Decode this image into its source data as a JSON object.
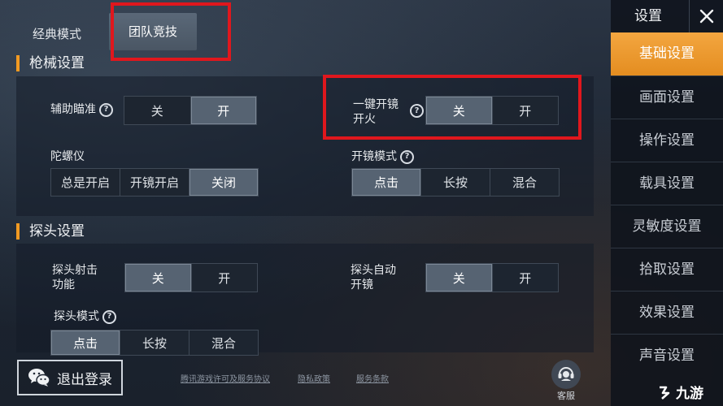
{
  "tabs": [
    {
      "label": "经典模式",
      "active": false
    },
    {
      "label": "团队竞技",
      "active": true
    }
  ],
  "sections": {
    "firearms": {
      "title": "枪械设置"
    },
    "peek": {
      "title": "探头设置"
    }
  },
  "settings": {
    "aim_assist": {
      "label": "辅助瞄准",
      "options": [
        "关",
        "开"
      ],
      "selected": "开"
    },
    "one_key_scope_fire": {
      "label_line1": "一键开镜",
      "label_line2": "开火",
      "options": [
        "关",
        "开"
      ],
      "selected": "关"
    },
    "gyro": {
      "label": "陀螺仪",
      "options": [
        "总是开启",
        "开镜开启",
        "关闭"
      ],
      "selected": "关闭"
    },
    "scope_mode": {
      "label": "开镜模式",
      "options": [
        "点击",
        "长按",
        "混合"
      ],
      "selected": "点击"
    },
    "peek_fire": {
      "label_line1": "探头射击",
      "label_line2": "功能",
      "options": [
        "关",
        "开"
      ],
      "selected": "关"
    },
    "peek_auto_scope": {
      "label_line1": "探头自动",
      "label_line2": "开镜",
      "options": [
        "关",
        "开"
      ],
      "selected": "关"
    },
    "peek_mode": {
      "label": "探头模式",
      "options": [
        "点击",
        "长按",
        "混合"
      ],
      "selected": "点击"
    }
  },
  "sidebar": {
    "title": "设置",
    "items": [
      {
        "label": "基础设置",
        "active": true
      },
      {
        "label": "画面设置",
        "active": false
      },
      {
        "label": "操作设置",
        "active": false
      },
      {
        "label": "载具设置",
        "active": false
      },
      {
        "label": "灵敏度设置",
        "active": false
      },
      {
        "label": "拾取设置",
        "active": false
      },
      {
        "label": "效果设置",
        "active": false
      },
      {
        "label": "声音设置",
        "active": false
      }
    ]
  },
  "footer": {
    "logout_label": "退出登录",
    "links": [
      "腾讯游戏许可及服务协议",
      "隐私政策",
      "服务条款"
    ],
    "service_label": "客服"
  },
  "watermark": "九游",
  "help_glyph": "?",
  "icons": [
    "wechat-icon",
    "close-icon",
    "help-icon",
    "customer-service-icon",
    "logo-icon"
  ],
  "colors": {
    "accent": "#f29a22",
    "sidebar_active": "#e8932a",
    "selected_option": "#566372",
    "highlight_box": "#e0171d"
  }
}
